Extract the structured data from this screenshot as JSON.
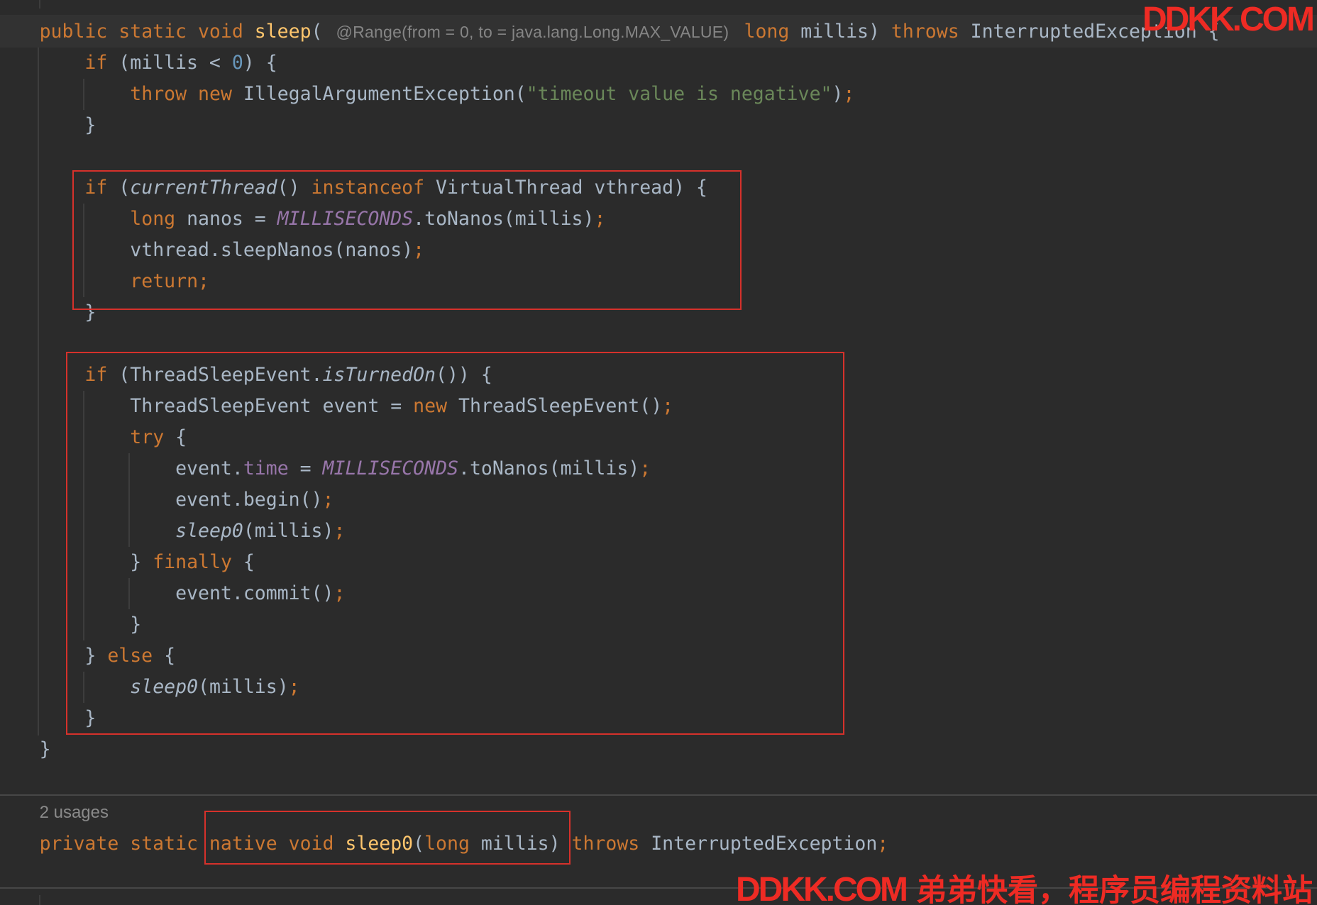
{
  "theme": {
    "bg": "#2b2b2b",
    "line_highlight": "#323232",
    "keyword": "#cc7832",
    "method": "#ffc66d",
    "text": "#a9b7c6",
    "number": "#6897bb",
    "string": "#6a8759",
    "constant": "#9876aa",
    "hint": "#858585",
    "usages": "#8a8a8a",
    "guide": "#3d3d3d",
    "separator": "#474747",
    "box": "#d6312b",
    "watermark": "#ee2b24"
  },
  "editor": {
    "lines": [
      [
        "public ",
        "static ",
        "void ",
        "sleep",
        "(",
        "@Range(from = 0, to = java.lang.Long.MAX_VALUE)",
        "long ",
        "millis) ",
        "throws ",
        "InterruptedException {"
      ],
      [
        "if ",
        "(millis < ",
        "0",
        ") {"
      ],
      [
        "throw ",
        "new ",
        "IllegalArgumentException(",
        "\"timeout value is negative\"",
        ")",
        ";"
      ],
      [
        "}"
      ],
      [],
      [
        "if ",
        "(",
        "currentThread",
        "() ",
        "instanceof ",
        "VirtualThread vthread) {"
      ],
      [
        "long ",
        "nanos = ",
        "MILLISECONDS",
        ".toNanos(millis)",
        ";"
      ],
      [
        "vthread.sleepNanos(nanos)",
        ";"
      ],
      [
        "return",
        ";"
      ],
      [
        "}"
      ],
      [],
      [
        "if ",
        "(ThreadSleepEvent.",
        "isTurnedOn",
        "()) {"
      ],
      [
        "ThreadSleepEvent event = ",
        "new ",
        "ThreadSleepEvent()",
        ";"
      ],
      [
        "try ",
        "{"
      ],
      [
        "event.",
        "time",
        " = ",
        "MILLISECONDS",
        ".toNanos(millis)",
        ";"
      ],
      [
        "event.begin()",
        ";"
      ],
      [
        "sleep0",
        "(millis)",
        ";"
      ],
      [
        "} ",
        "finally ",
        "{"
      ],
      [
        "event.commit()",
        ";"
      ],
      [
        "}"
      ],
      [
        "} ",
        "else ",
        "{"
      ],
      [
        "sleep0",
        "(millis)",
        ";"
      ],
      [
        "}"
      ],
      [
        "}"
      ]
    ],
    "usages_hint": "2 usages",
    "native_declaration": [
      "private ",
      "static ",
      "native ",
      "void ",
      "sleep0",
      "(",
      "long ",
      "millis) ",
      "throws ",
      "InterruptedException",
      ";"
    ]
  },
  "watermarks": {
    "top": "DDKK.COM",
    "bottom_brand": "DDKK.COM",
    "bottom_tagline": "弟弟快看，程序员编程资料站"
  }
}
